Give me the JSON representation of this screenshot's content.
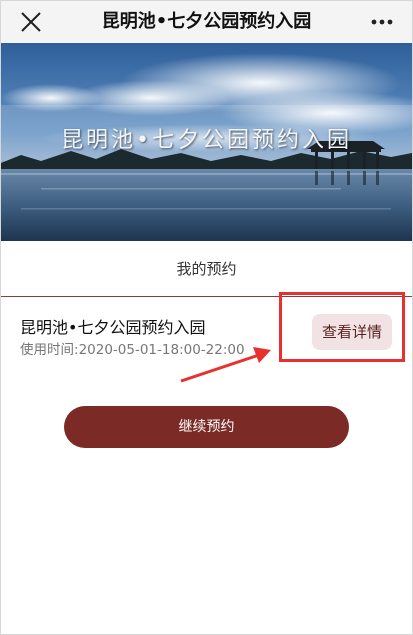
{
  "topbar": {
    "title": "昆明池•七夕公园预约入园",
    "close_icon": "close-icon",
    "more_icon": "more-dots-icon"
  },
  "banner": {
    "title": "昆明池•七夕公园预约入园"
  },
  "section": {
    "title": "我的预约"
  },
  "reservation": {
    "name": "昆明池•七夕公园预约入园",
    "time_label": "使用时间:",
    "time_value": "2020-05-01-18:00-22:00",
    "details_label": "查看详情"
  },
  "continue_label": "继续预约",
  "colors": {
    "accent": "#7b2a25",
    "details_bg": "#f1e3e3",
    "highlight": "#e8302f",
    "divider": "#8a3b3b"
  }
}
